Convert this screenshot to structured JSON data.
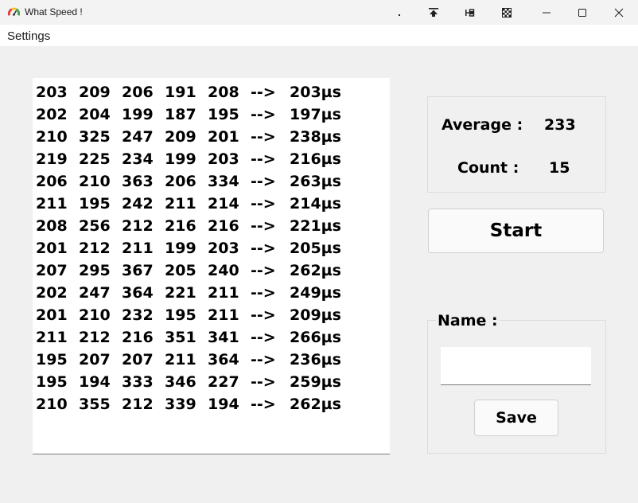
{
  "window": {
    "title": "What Speed !"
  },
  "menu": {
    "settings": "Settings"
  },
  "log": {
    "arrow": "-->",
    "rows": [
      {
        "v": [
          "203",
          "209",
          "206",
          "191",
          "208"
        ],
        "result": "203µs"
      },
      {
        "v": [
          "202",
          "204",
          "199",
          "187",
          "195"
        ],
        "result": "197µs"
      },
      {
        "v": [
          "210",
          "325",
          "247",
          "209",
          "201"
        ],
        "result": "238µs"
      },
      {
        "v": [
          "219",
          "225",
          "234",
          "199",
          "203"
        ],
        "result": "216µs"
      },
      {
        "v": [
          "206",
          "210",
          "363",
          "206",
          "334"
        ],
        "result": "263µs"
      },
      {
        "v": [
          "211",
          "195",
          "242",
          "211",
          "214"
        ],
        "result": "214µs"
      },
      {
        "v": [
          "208",
          "256",
          "212",
          "216",
          "216"
        ],
        "result": "221µs"
      },
      {
        "v": [
          "201",
          "212",
          "211",
          "199",
          "203"
        ],
        "result": "205µs"
      },
      {
        "v": [
          "207",
          "295",
          "367",
          "205",
          "240"
        ],
        "result": "262µs"
      },
      {
        "v": [
          "202",
          "247",
          "364",
          "221",
          "211"
        ],
        "result": "249µs"
      },
      {
        "v": [
          "201",
          "210",
          "232",
          "195",
          "211"
        ],
        "result": "209µs"
      },
      {
        "v": [
          "211",
          "212",
          "216",
          "351",
          "341"
        ],
        "result": "266µs"
      },
      {
        "v": [
          "195",
          "207",
          "207",
          "211",
          "364"
        ],
        "result": "236µs"
      },
      {
        "v": [
          "195",
          "194",
          "333",
          "346",
          "227"
        ],
        "result": "259µs"
      },
      {
        "v": [
          "210",
          "355",
          "212",
          "339",
          "194"
        ],
        "result": "262µs"
      }
    ]
  },
  "stats": {
    "average_label": "Average :",
    "average_value": "233",
    "count_label": "Count :",
    "count_value": "15"
  },
  "buttons": {
    "start": "Start",
    "save": "Save"
  },
  "name_group": {
    "label": "Name :",
    "value": ""
  },
  "icons": {
    "app": "speedometer-icon",
    "titlebar": [
      "pin-dot-icon",
      "keep-on-top-icon",
      "pin-icon",
      "checker-icon",
      "minimize-icon",
      "maximize-icon",
      "close-icon"
    ]
  }
}
